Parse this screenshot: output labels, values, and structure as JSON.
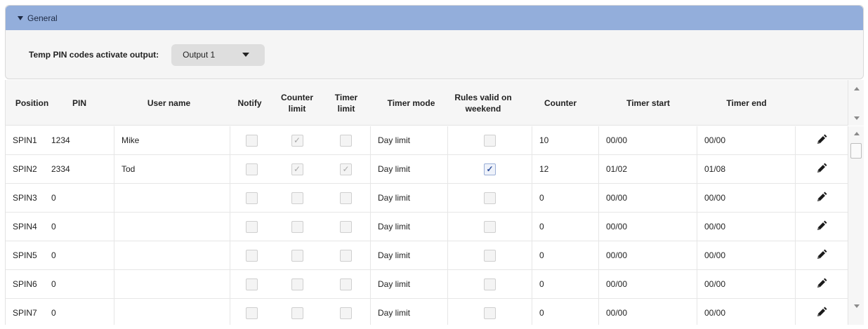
{
  "panel": {
    "title": "General",
    "output_label": "Temp PIN codes activate output:",
    "output_value": "Output 1"
  },
  "table": {
    "columns": {
      "position": "Position",
      "pin": "PIN",
      "user_name": "User name",
      "notify": "Notify",
      "counter_limit_1": "Counter",
      "counter_limit_2": "limit",
      "timer_limit_1": "Timer",
      "timer_limit_2": "limit",
      "timer_mode": "Timer mode",
      "rules_weekend_1": "Rules valid on",
      "rules_weekend_2": "weekend",
      "counter": "Counter",
      "timer_start": "Timer start",
      "timer_end": "Timer end"
    },
    "rows": [
      {
        "position": "SPIN1",
        "pin": "1234",
        "user_name": "Mike",
        "notify": false,
        "counter_limit": true,
        "timer_limit": false,
        "timer_mode": "Day limit",
        "rules_weekend": false,
        "counter": "10",
        "timer_start": "00/00",
        "timer_end": "00/00"
      },
      {
        "position": "SPIN2",
        "pin": "2334",
        "user_name": "Tod",
        "notify": false,
        "counter_limit": true,
        "timer_limit": true,
        "timer_mode": "Day limit",
        "rules_weekend": true,
        "counter": "12",
        "timer_start": "01/02",
        "timer_end": "01/08"
      },
      {
        "position": "SPIN3",
        "pin": "0",
        "user_name": "",
        "notify": false,
        "counter_limit": false,
        "timer_limit": false,
        "timer_mode": "Day limit",
        "rules_weekend": false,
        "counter": "0",
        "timer_start": "00/00",
        "timer_end": "00/00"
      },
      {
        "position": "SPIN4",
        "pin": "0",
        "user_name": "",
        "notify": false,
        "counter_limit": false,
        "timer_limit": false,
        "timer_mode": "Day limit",
        "rules_weekend": false,
        "counter": "0",
        "timer_start": "00/00",
        "timer_end": "00/00"
      },
      {
        "position": "SPIN5",
        "pin": "0",
        "user_name": "",
        "notify": false,
        "counter_limit": false,
        "timer_limit": false,
        "timer_mode": "Day limit",
        "rules_weekend": false,
        "counter": "0",
        "timer_start": "00/00",
        "timer_end": "00/00"
      },
      {
        "position": "SPIN6",
        "pin": "0",
        "user_name": "",
        "notify": false,
        "counter_limit": false,
        "timer_limit": false,
        "timer_mode": "Day limit",
        "rules_weekend": false,
        "counter": "0",
        "timer_start": "00/00",
        "timer_end": "00/00"
      },
      {
        "position": "SPIN7",
        "pin": "0",
        "user_name": "",
        "notify": false,
        "counter_limit": false,
        "timer_limit": false,
        "timer_mode": "Day limit",
        "rules_weekend": false,
        "counter": "0",
        "timer_start": "00/00",
        "timer_end": "00/00"
      }
    ]
  },
  "icons": {
    "panel_toggle": "triangle-down-icon",
    "select_caret": "caret-down-icon",
    "edit": "pencil-icon",
    "scroll_up": "scroll-up-icon",
    "scroll_down": "scroll-down-icon"
  },
  "colors": {
    "panel_header": "#93aedb",
    "checkbox_active": "#2e4f9c"
  }
}
